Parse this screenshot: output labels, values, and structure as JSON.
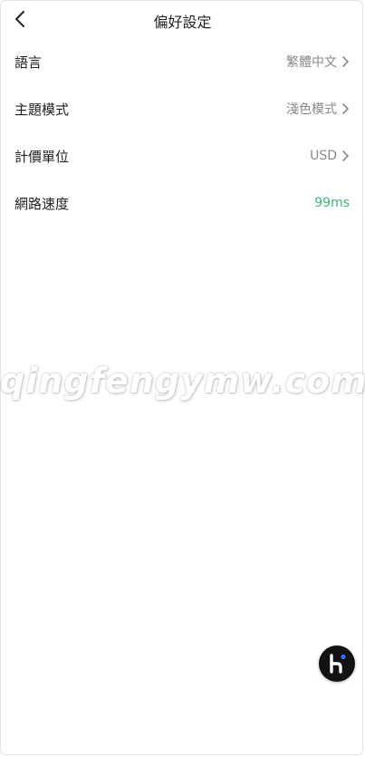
{
  "header": {
    "title": "偏好設定",
    "back_icon": "chevron-left-icon"
  },
  "settings": [
    {
      "label": "語言",
      "value": "繁體中文",
      "has_chevron": true
    },
    {
      "label": "主題模式",
      "value": "淺色模式",
      "has_chevron": true
    },
    {
      "label": "計價單位",
      "value": "USD",
      "has_chevron": true
    },
    {
      "label": "網路速度",
      "value": "99ms",
      "has_chevron": false,
      "value_color": "#3fb57a"
    }
  ],
  "watermark": "qingfengymw.com",
  "fab": {
    "icon": "k-logo-icon",
    "accent_dot_color": "#3b6cff"
  },
  "colors": {
    "text_primary": "#222222",
    "text_secondary": "#888888",
    "speed_ok": "#3fb57a",
    "fab_bg": "#121212"
  }
}
